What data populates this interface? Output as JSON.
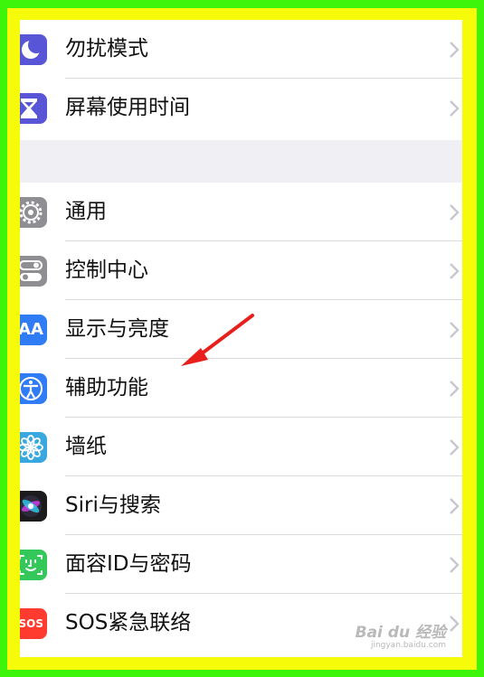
{
  "settings": {
    "group_1": [
      {
        "label": "勿扰模式",
        "icon": "moon-icon",
        "icon_color": "#5856d6"
      },
      {
        "label": "屏幕使用时间",
        "icon": "hourglass-icon",
        "icon_color": "#5856d6"
      }
    ],
    "group_2": [
      {
        "label": "通用",
        "icon": "gear-icon",
        "icon_color": "#8e8e93"
      },
      {
        "label": "控制中心",
        "icon": "toggles-icon",
        "icon_color": "#8e8e93"
      },
      {
        "label": "显示与亮度",
        "icon": "text-size-icon",
        "icon_color": "#2f7cf6",
        "icon_text": "AA"
      },
      {
        "label": "辅助功能",
        "icon": "accessibility-icon",
        "icon_color": "#2f7cf6"
      },
      {
        "label": "墙纸",
        "icon": "flower-icon",
        "icon_color": "#3aa8e0"
      },
      {
        "label": "Siri与搜索",
        "icon": "siri-icon",
        "icon_color": "#1c1c1e"
      },
      {
        "label": "面容ID与密码",
        "icon": "face-id-icon",
        "icon_color": "#34c759"
      },
      {
        "label": "SOS紧急联络",
        "icon": "sos-icon",
        "icon_color": "#ff3b30",
        "icon_text": "SOS"
      }
    ]
  },
  "colors": {
    "frame_outer": "#3cf50a",
    "frame_inner": "#f6fb0a",
    "annotation_arrow": "#e8201c"
  },
  "watermark": {
    "logo": "Bai du 经验",
    "url": "jingyan.baidu.com"
  }
}
